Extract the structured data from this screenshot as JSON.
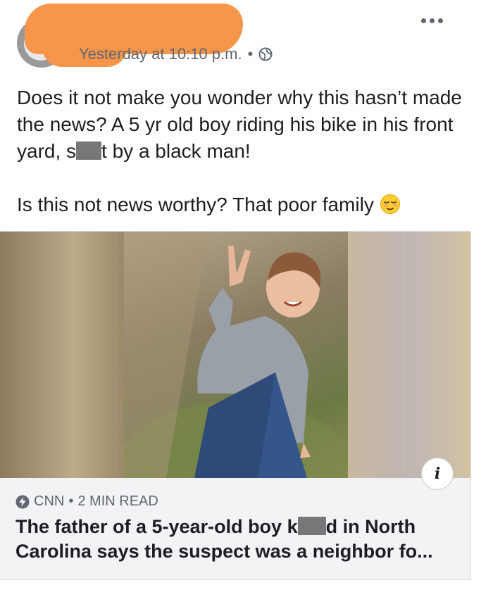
{
  "post": {
    "timestamp": "Yesterday at 10:10 p.m.",
    "separator": "•",
    "privacy_icon": "globe-icon",
    "more_icon": "ellipsis-icon",
    "text": {
      "p1_before": "Does it not make you wonder why this hasn’t made the news? A 5 yr old boy riding his bike in his front yard, s",
      "p1_after": "t by a black man!",
      "p2": "Is this not news worthy?  That poor family",
      "emoji": "relieved-face-emoji"
    }
  },
  "link_card": {
    "source_icon": "lightning-bolt-icon",
    "source": "CNN",
    "separator": "•",
    "read_time": "2 MIN READ",
    "headline_before": "The father of a 5-year-old boy k",
    "headline_after": "d in North Carolina says the suspect was a neighbor fo...",
    "info_label": "i",
    "colors": {
      "caption_bg": "#f2f3f5",
      "meta_text": "#606770",
      "redaction": "#f7954b"
    }
  }
}
